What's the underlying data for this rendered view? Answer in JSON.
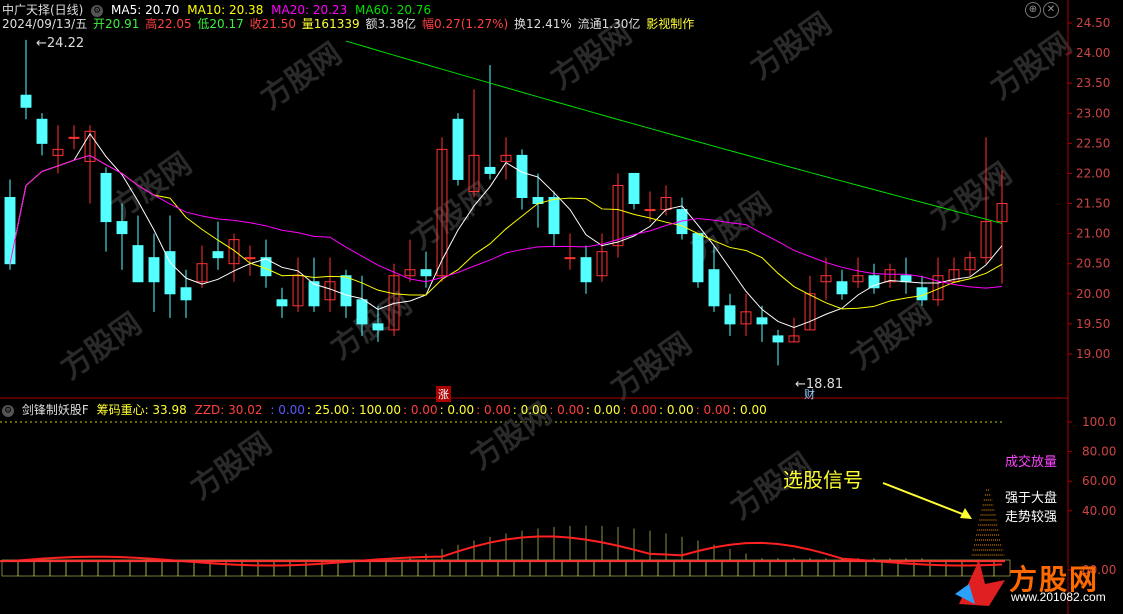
{
  "header": {
    "title": "中广天择(日线)",
    "ma5": "MA5: 20.70",
    "ma10": "MA10: 20.38",
    "ma20": "MA20: 20.23",
    "ma60": "MA60: 20.76",
    "date": "2024/09/13/五",
    "open": "开20.91",
    "high": "高22.05",
    "low": "低20.17",
    "close": "收21.50",
    "volume": "量161339",
    "amount": "额3.38亿",
    "change": "幅0.27(1.27%)",
    "turnover": "换12.41%",
    "float": "流通1.30亿",
    "credit": "影视制作",
    "high_marker": "24.22",
    "low_marker": "18.81",
    "zhang_badge": "涨",
    "cai_badge": "财"
  },
  "indicator": {
    "name": "剑锋制妖股F",
    "chip": "筹码重心: 33.98",
    "zzd": "ZZD: 30.02",
    "values": [
      ": 0.00",
      ": 25.00",
      ": 100.00",
      ": 0.00",
      ": 0.00",
      ": 0.00",
      ": 0.00",
      ": 0.00",
      ": 0.00",
      ": 0.00",
      ": 0.00",
      ": 0.00",
      ": 0.00"
    ],
    "label_volume": "成交放量",
    "label_strong1": "强于大盘",
    "label_strong2": "走势较强",
    "signal": "选股信号"
  },
  "price_axis": [
    "24.50",
    "24.00",
    "23.50",
    "23.00",
    "22.50",
    "22.00",
    "21.50",
    "21.00",
    "20.50",
    "20.00",
    "19.50",
    "19.00"
  ],
  "ind_axis": [
    "100.0",
    "80.00",
    "60.00",
    "40.00",
    "00.00"
  ],
  "logo": {
    "text": "方股网",
    "url": "www.201082.com"
  },
  "colors": {
    "up": "#ff3232",
    "down": "#54ffff",
    "ma5": "#ffffff",
    "ma10": "#ffff00",
    "ma20": "#ff00ff",
    "ma60": "#00e000"
  },
  "chart_data": {
    "type": "candlestick",
    "candles": [
      [
        21.6,
        20.5,
        21.9,
        20.4
      ],
      [
        23.3,
        23.1,
        24.22,
        22.9
      ],
      [
        22.9,
        22.5,
        23.0,
        22.3
      ],
      [
        22.3,
        22.4,
        22.8,
        22.0
      ],
      [
        22.6,
        22.6,
        22.8,
        22.4
      ],
      [
        22.2,
        22.7,
        22.8,
        21.5
      ],
      [
        22.0,
        21.2,
        22.1,
        20.7
      ],
      [
        21.2,
        21.0,
        21.5,
        20.4
      ],
      [
        20.8,
        20.2,
        21.3,
        20.2
      ],
      [
        20.6,
        20.2,
        21.0,
        19.7
      ],
      [
        20.7,
        20.0,
        21.3,
        19.6
      ],
      [
        20.1,
        19.9,
        20.4,
        19.6
      ],
      [
        20.2,
        20.5,
        20.8,
        20.1
      ],
      [
        20.7,
        20.6,
        21.2,
        20.4
      ],
      [
        20.5,
        20.9,
        21.0,
        20.2
      ],
      [
        20.6,
        20.6,
        20.8,
        20.3
      ],
      [
        20.6,
        20.3,
        20.9,
        20.1
      ],
      [
        19.9,
        19.8,
        20.1,
        19.6
      ],
      [
        19.8,
        20.3,
        20.6,
        19.7
      ],
      [
        20.2,
        19.8,
        20.6,
        19.7
      ],
      [
        19.9,
        20.2,
        20.6,
        19.7
      ],
      [
        20.3,
        19.8,
        20.4,
        19.6
      ],
      [
        19.9,
        19.5,
        20.3,
        19.3
      ],
      [
        19.5,
        19.4,
        19.8,
        19.2
      ],
      [
        19.4,
        20.3,
        20.5,
        19.3
      ],
      [
        20.3,
        20.4,
        20.9,
        20.2
      ],
      [
        20.4,
        20.3,
        20.7,
        20.1
      ],
      [
        20.3,
        22.4,
        22.6,
        20.2
      ],
      [
        22.9,
        21.9,
        23.0,
        21.8
      ],
      [
        21.7,
        22.3,
        23.4,
        21.6
      ],
      [
        22.1,
        22.0,
        23.8,
        21.9
      ],
      [
        22.2,
        22.3,
        22.6,
        21.9
      ],
      [
        22.3,
        21.6,
        22.4,
        21.4
      ],
      [
        21.6,
        21.5,
        22.0,
        21.1
      ],
      [
        21.6,
        21.0,
        21.7,
        20.8
      ],
      [
        20.6,
        20.6,
        21.0,
        20.4
      ],
      [
        20.6,
        20.2,
        20.8,
        20.0
      ],
      [
        20.3,
        20.7,
        21.0,
        20.2
      ],
      [
        20.8,
        21.8,
        22.0,
        20.6
      ],
      [
        22.0,
        21.5,
        22.0,
        21.4
      ],
      [
        21.4,
        21.4,
        21.7,
        21.2
      ],
      [
        21.4,
        21.6,
        21.8,
        21.3
      ],
      [
        21.4,
        21.0,
        21.6,
        20.9
      ],
      [
        21.0,
        20.2,
        21.0,
        20.1
      ],
      [
        20.4,
        19.8,
        20.8,
        19.7
      ],
      [
        19.8,
        19.5,
        20.0,
        19.3
      ],
      [
        19.5,
        19.7,
        20.0,
        19.3
      ],
      [
        19.6,
        19.5,
        19.8,
        19.2
      ],
      [
        19.3,
        19.2,
        19.4,
        18.81
      ],
      [
        19.2,
        19.3,
        19.6,
        19.2
      ],
      [
        19.4,
        20.0,
        20.3,
        19.4
      ],
      [
        20.2,
        20.3,
        20.6,
        19.9
      ],
      [
        20.2,
        20.0,
        20.4,
        19.9
      ],
      [
        20.2,
        20.3,
        20.6,
        20.1
      ],
      [
        20.3,
        20.1,
        20.5,
        20.0
      ],
      [
        20.2,
        20.4,
        20.5,
        20.1
      ],
      [
        20.3,
        20.2,
        20.6,
        20.0
      ],
      [
        20.1,
        19.9,
        20.3,
        19.8
      ],
      [
        19.9,
        20.3,
        20.6,
        19.8
      ],
      [
        20.2,
        20.4,
        20.6,
        20.2
      ],
      [
        20.4,
        20.6,
        20.7,
        20.3
      ],
      [
        20.6,
        21.2,
        22.6,
        20.5
      ],
      [
        21.2,
        21.5,
        22.05,
        20.17
      ]
    ],
    "ylim": [
      18.7,
      24.6
    ]
  }
}
